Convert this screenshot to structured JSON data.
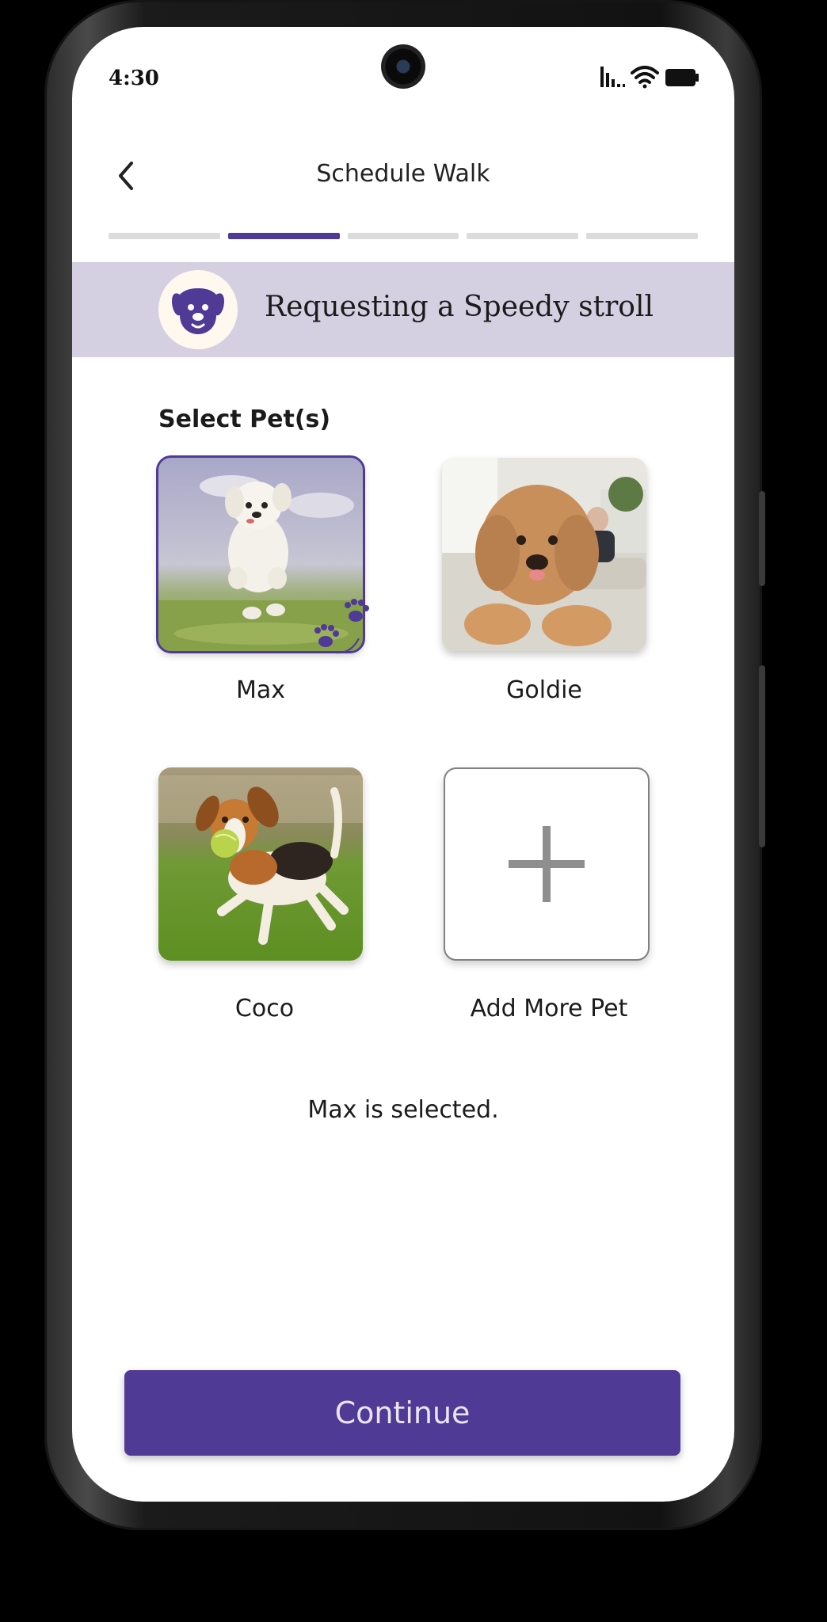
{
  "status_bar": {
    "time": "4:30",
    "icons": [
      "signal-icon",
      "wifi-icon",
      "battery-icon"
    ]
  },
  "header": {
    "back_icon": "chevron-left-icon",
    "title": "Schedule Walk"
  },
  "progress": {
    "total_steps": 5,
    "current_step": 2
  },
  "banner": {
    "icon": "dog-face-icon",
    "title": "Requesting a Speedy stroll"
  },
  "pets_section": {
    "label": "Select Pet(s)",
    "pets": [
      {
        "name": "Max",
        "selected": true
      },
      {
        "name": "Goldie",
        "selected": false
      },
      {
        "name": "Coco",
        "selected": false
      }
    ],
    "add_more": {
      "label": "Add More Pet",
      "icon": "plus-icon"
    }
  },
  "selection_message": "Max is  selected.",
  "continue_button": {
    "label": "Continue"
  },
  "colors": {
    "accent": "#4f3a96",
    "banner_bg": "#d4d0e2",
    "progress_inactive": "#dcdcdc"
  }
}
